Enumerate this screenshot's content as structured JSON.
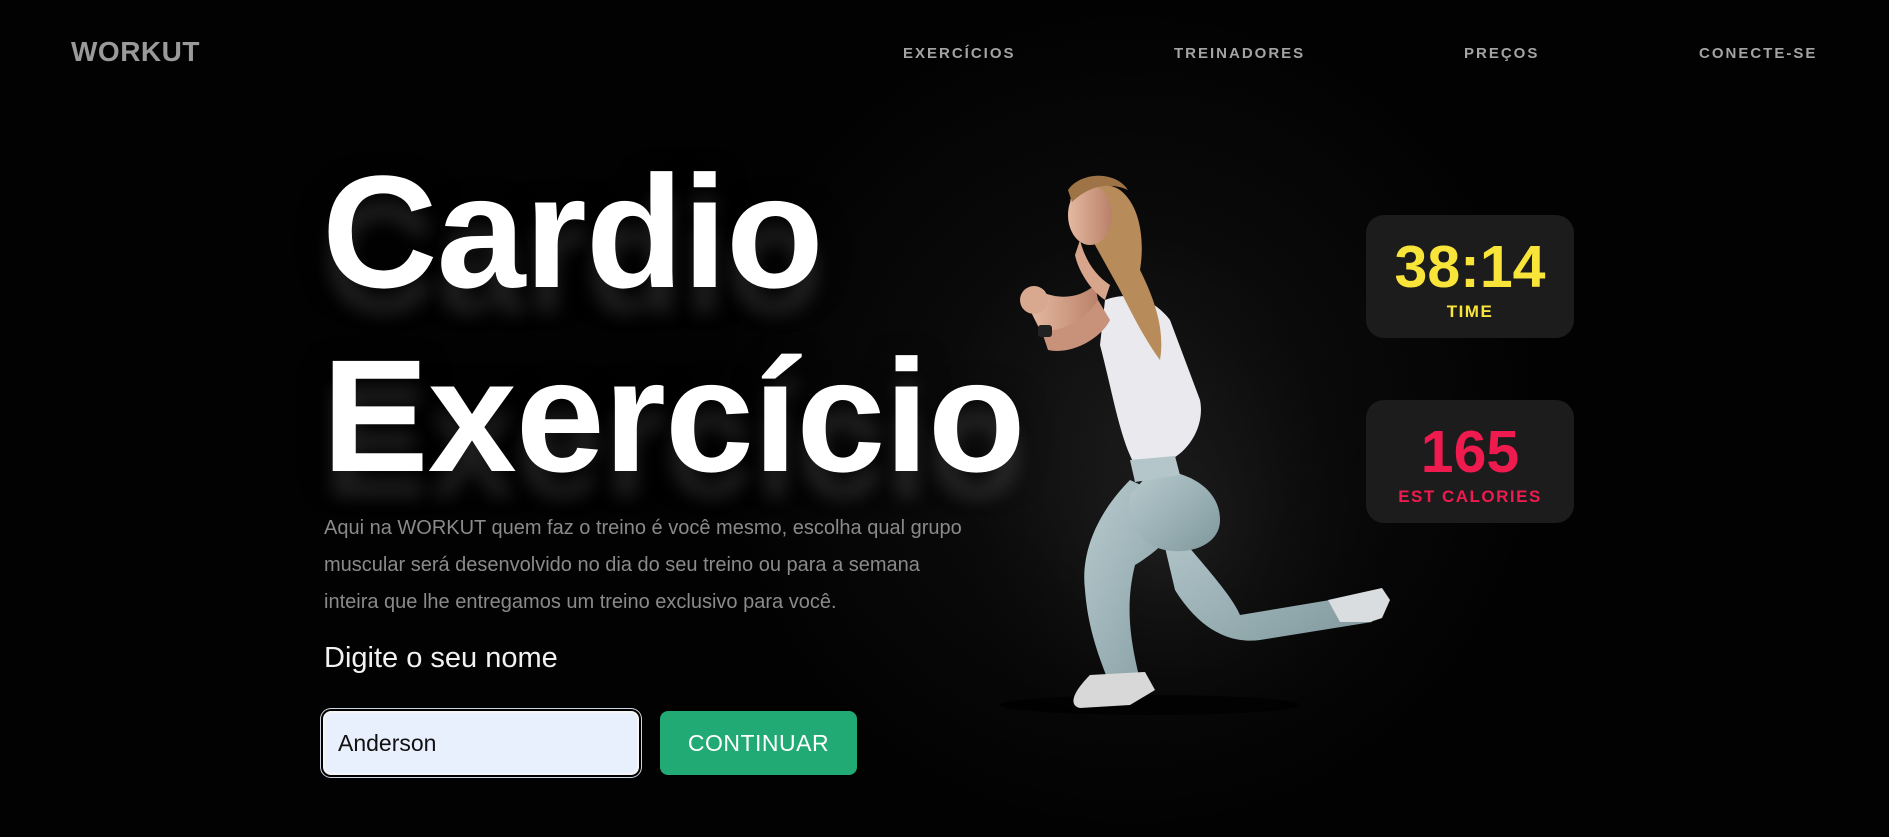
{
  "brand": {
    "logo": "WORKUT"
  },
  "nav": {
    "items": [
      {
        "label": "EXERCÍCIOS"
      },
      {
        "label": "TREINADORES"
      },
      {
        "label": "PREÇOS"
      },
      {
        "label": "CONECTE-SE"
      }
    ]
  },
  "hero": {
    "title_line1": "Cardio",
    "title_line2": "Exercício",
    "description": "Aqui na WORKUT quem faz o treino é você mesmo, escolha qual grupo muscular será desenvolvido no dia do seu treino ou para a semana inteira que lhe entregamos um treino exclusivo para você.",
    "name_label": "Digite o seu nome",
    "name_value": "Anderson",
    "continue_label": "CONTINUAR"
  },
  "stats": {
    "time": {
      "value": "38:14",
      "label": "TIME",
      "color": "#f9e43a"
    },
    "calories": {
      "value": "165",
      "label": "EST CALORIES",
      "color": "#ef1a4e"
    }
  },
  "colors": {
    "background": "#020202",
    "accent_button": "#21aa74",
    "card": "#1c1c1d"
  }
}
